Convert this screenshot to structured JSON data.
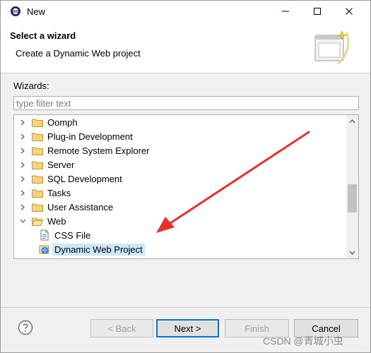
{
  "window": {
    "title": "New",
    "minimize_label": "—",
    "maximize_label": "☐",
    "close_label": "✕"
  },
  "header": {
    "title": "Select a wizard",
    "description": "Create a Dynamic Web project"
  },
  "wizards": {
    "label": "Wizards:",
    "filter_placeholder": "type filter text",
    "tree": [
      {
        "label": "Oomph",
        "expanded": false,
        "level": 0,
        "icon": "folder-icon"
      },
      {
        "label": "Plug-in Development",
        "expanded": false,
        "level": 0,
        "icon": "folder-icon"
      },
      {
        "label": "Remote System Explorer",
        "expanded": false,
        "level": 0,
        "icon": "folder-icon"
      },
      {
        "label": "Server",
        "expanded": false,
        "level": 0,
        "icon": "folder-icon"
      },
      {
        "label": "SQL Development",
        "expanded": false,
        "level": 0,
        "icon": "folder-icon"
      },
      {
        "label": "Tasks",
        "expanded": false,
        "level": 0,
        "icon": "folder-icon"
      },
      {
        "label": "User Assistance",
        "expanded": false,
        "level": 0,
        "icon": "folder-icon"
      },
      {
        "label": "Web",
        "expanded": true,
        "level": 0,
        "icon": "folder-open-icon"
      },
      {
        "label": "CSS File",
        "level": 1,
        "icon": "css-file-icon"
      },
      {
        "label": "Dynamic Web Project",
        "level": 1,
        "icon": "dynamic-web-project-icon",
        "selected": true
      }
    ]
  },
  "buttons": {
    "back": "< Back",
    "next": "Next >",
    "finish": "Finish",
    "cancel": "Cancel"
  },
  "colors": {
    "selection": "#cce8ff",
    "annotation_arrow": "#e8312a",
    "default_button_border": "#0078d7"
  },
  "watermark": "CSDN @青城小虫"
}
